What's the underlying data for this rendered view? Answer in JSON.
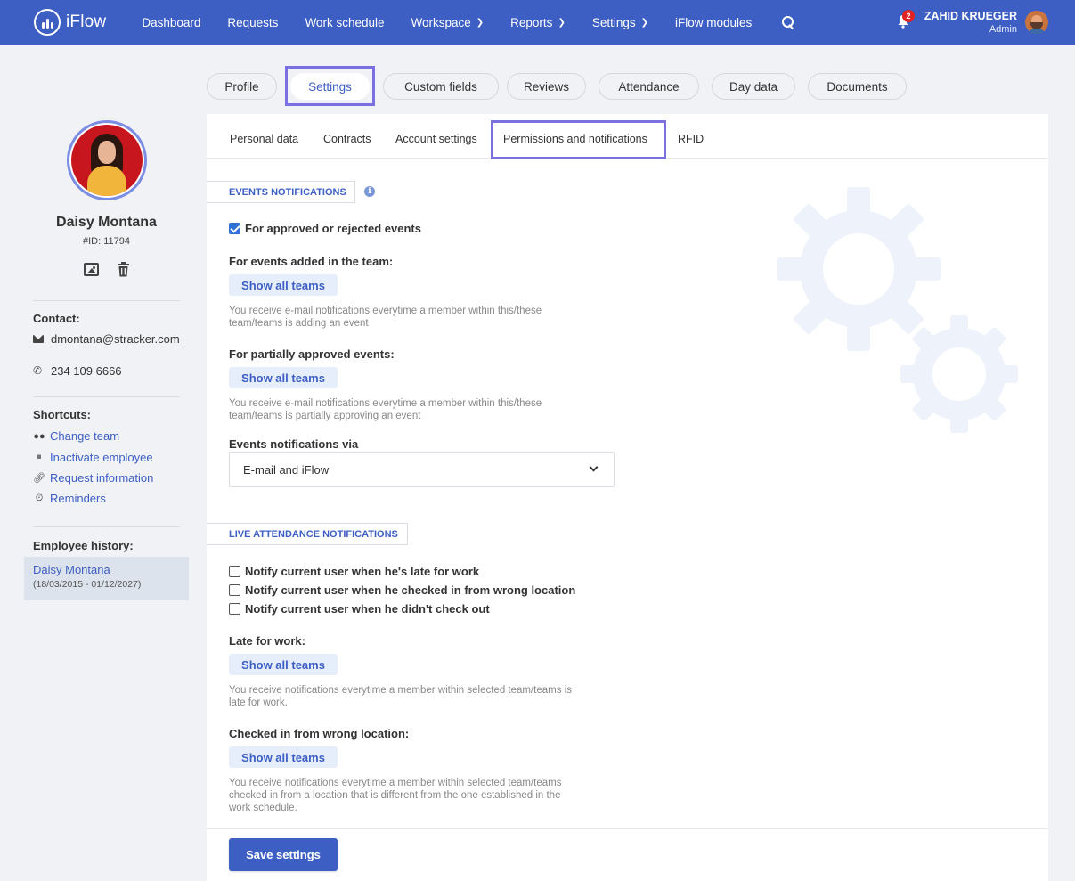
{
  "app": {
    "name": "iFlow"
  },
  "nav": {
    "items": [
      {
        "label": "Dashboard",
        "chevron": false
      },
      {
        "label": "Requests",
        "chevron": false
      },
      {
        "label": "Work schedule",
        "chevron": false
      },
      {
        "label": "Workspace",
        "chevron": true
      },
      {
        "label": "Reports",
        "chevron": true
      },
      {
        "label": "Settings",
        "chevron": true
      },
      {
        "label": "iFlow modules",
        "chevron": false
      }
    ],
    "notifications_count": "2",
    "user_name": "ZAHID KRUEGER",
    "user_role": "Admin"
  },
  "colors": {
    "primary": "#3d5fc4",
    "highlight": "#7b70e0",
    "badge": "#e02424"
  },
  "employee": {
    "name": "Daisy Montana",
    "id": "#ID: 11794",
    "contact_heading": "Contact:",
    "email": "dmontana@stracker.com",
    "phone": "234 109 6666",
    "shortcuts_heading": "Shortcuts:",
    "shortcuts": [
      "Change team",
      "Inactivate employee",
      "Request information",
      "Reminders"
    ],
    "history_heading": "Employee history:",
    "history_name": "Daisy Montana",
    "history_dates": "(18/03/2015 - 01/12/2027)"
  },
  "top_tabs": [
    "Profile",
    "Settings",
    "Custom fields",
    "Reviews",
    "Attendance",
    "Day data",
    "Documents"
  ],
  "sub_tabs": [
    "Personal data",
    "Contracts",
    "Account settings",
    "Permissions and notifications",
    "RFID"
  ],
  "events": {
    "section_title": "EVENTS NOTIFICATIONS",
    "approved_rejected": "For approved or rejected events",
    "added_label": "For events added in the team:",
    "show_all_teams": "Show all teams",
    "added_help_1": "You receive e-mail notifications everytime a member within this/these",
    "added_help_2": "team/teams is adding an event",
    "partial_label": "For partially approved events:",
    "partial_help_1": "You receive e-mail notifications everytime a member within this/these",
    "partial_help_2": "team/teams is partially approving an event",
    "via_label": "Events notifications via",
    "via_value": "E-mail and iFlow"
  },
  "live": {
    "section_title": "LIVE ATTENDANCE NOTIFICATIONS",
    "late_check": "Notify current user when he's late for work",
    "wrong_location_check": "Notify current user when he checked in from wrong location",
    "no_checkout_check": "Notify current user when he didn't check out",
    "late_label": "Late for work:",
    "late_help_1": "You receive notifications everytime a member within selected team/teams is",
    "late_help_2": "late for work.",
    "wrong_label": "Checked in from wrong location:",
    "wrong_help_1": "You receive notifications everytime a member within selected team/teams",
    "wrong_help_2": "checked in from a location that is different from the one established in the",
    "wrong_help_3": "work schedule."
  },
  "save_label": "Save settings"
}
